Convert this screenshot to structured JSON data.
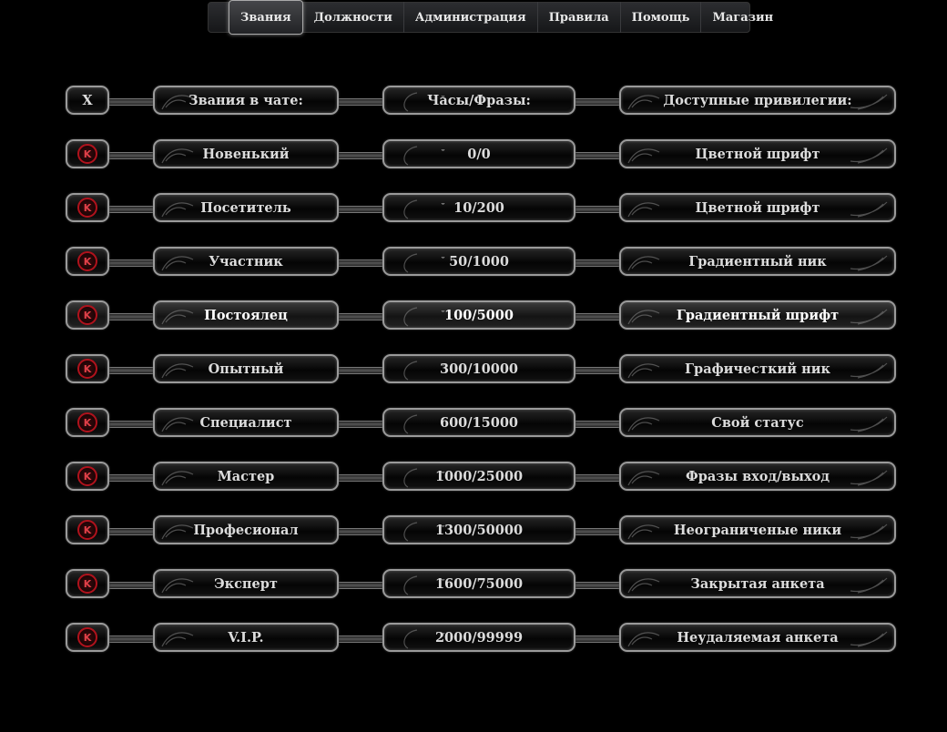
{
  "nav": {
    "items": [
      "Звания",
      "Должности",
      "Администрация",
      "Правила",
      "Помощь",
      "Магазин"
    ]
  },
  "header": {
    "close": "X",
    "rank": "Звания в чате:",
    "hours": "Часы/Фразы:",
    "privs": "Доступные привилегии:"
  },
  "rows": [
    {
      "rank": "Новенький",
      "hours": "0/0",
      "priv": "Цветной шрифт"
    },
    {
      "rank": "Посетитель",
      "hours": "10/200",
      "priv": "Цветной шрифт"
    },
    {
      "rank": "Участник",
      "hours": "50/1000",
      "priv": "Градиентный ник"
    },
    {
      "rank": "Постоялец",
      "hours": "100/5000",
      "priv": "Градиентный шрифт"
    },
    {
      "rank": "Опытный",
      "hours": "300/10000",
      "priv": "Графичесткий ник"
    },
    {
      "rank": "Специалист",
      "hours": "600/15000",
      "priv": "Свой статус"
    },
    {
      "rank": "Мастер",
      "hours": "1000/25000",
      "priv": "Фразы вход/выход"
    },
    {
      "rank": "Професионал",
      "hours": "1300/50000",
      "priv": "Неограниченые ники"
    },
    {
      "rank": "Эксперт",
      "hours": "1600/75000",
      "priv": "Закрытая анкета"
    },
    {
      "rank": "V.I.P.",
      "hours": "2000/99999",
      "priv": "Неудаляемая анкета"
    }
  ],
  "badge_letter": "K",
  "colors": {
    "background": "#000000",
    "badge": "#b0121c",
    "border": "#9a9a9a"
  }
}
